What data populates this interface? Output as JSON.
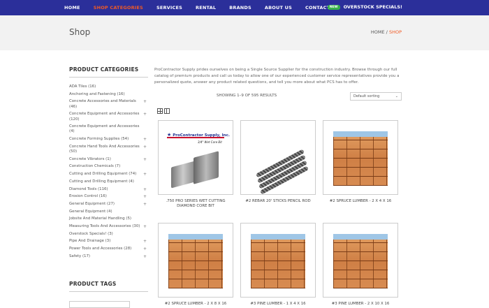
{
  "nav": {
    "items": [
      "HOME",
      "SHOP CATEGORIES",
      "SERVICES",
      "RENTAL",
      "BRANDS",
      "ABOUT US",
      "CONTACT US"
    ],
    "active_index": 1,
    "new_badge": "NEW",
    "special_label": "OVERSTOCK SPECIALS!"
  },
  "page": {
    "title": "Shop",
    "breadcrumb_home": "HOME",
    "breadcrumb_sep": "/",
    "breadcrumb_current": "SHOP"
  },
  "sidebar": {
    "title": "PRODUCT CATEGORIES",
    "categories": [
      {
        "label": "ADA Tiles (16)",
        "expandable": false
      },
      {
        "label": "Anchoring and Fastening (16)",
        "expandable": false
      },
      {
        "label": "Concrete Accessories and Materials (46)",
        "expandable": true
      },
      {
        "label": "Concrete Equipment and Accessories (120)",
        "expandable": true
      },
      {
        "label": "Concrete Equipment and Accessories (4)",
        "expandable": false
      },
      {
        "label": "Concrete Forming Supplies (54)",
        "expandable": true
      },
      {
        "label": "Concrete Hand Tools And Accessories (50)",
        "expandable": true
      },
      {
        "label": "Concrete Vibrators (1)",
        "expandable": true
      },
      {
        "label": "Construction Chemicals (7)",
        "expandable": false
      },
      {
        "label": "Cutting and Drilling Equipment (74)",
        "expandable": true
      },
      {
        "label": "Cutting and Drilling Equipment (4)",
        "expandable": false
      },
      {
        "label": "Diamond Tools (116)",
        "expandable": true
      },
      {
        "label": "Erosion Control (16)",
        "expandable": true
      },
      {
        "label": "General Equipment (27)",
        "expandable": true
      },
      {
        "label": "General Equipment (4)",
        "expandable": false
      },
      {
        "label": "Jobsite And Material Handling (5)",
        "expandable": false
      },
      {
        "label": "Measuring Tools And Accessories (30)",
        "expandable": true
      },
      {
        "label": "Overstock Specials! (3)",
        "expandable": false
      },
      {
        "label": "Pipe And Drainage (3)",
        "expandable": true
      },
      {
        "label": "Power Tools and Accessories (28)",
        "expandable": true
      },
      {
        "label": "Safety (17)",
        "expandable": true
      }
    ],
    "plus_glyph": "+",
    "tags_title": "PRODUCT TAGS"
  },
  "shop": {
    "intro": "ProContractor Supply prides ourselves on being a Single Source Supplier for the construction industry. Browse through our full catalog of premium products and call us today to allow one of our experienced customer service representatives provide you a personalized quote, answer any product related questions, and tell you more about what PCS has to offer.",
    "result_count": "SHOWING 1–9 OF 595 RESULTS",
    "sort_value": "Default sorting",
    "products": [
      {
        "name": ".750 PRO SERIES WET CUTTING DIAMOND CORE BIT",
        "image": "core-bit",
        "logo_text": "ProContractor Supply, Inc.",
        "logo_sub": "3/4\" Wet Core Bit"
      },
      {
        "name": "#2 REBAR 20' STICKS PENCIL ROD",
        "image": "rebar"
      },
      {
        "name": "#2 SPRUCE LUMBER - 2 X 4 X 16",
        "image": "lumber"
      },
      {
        "name": "#2 SPRUCE LUMBER - 2 X 8 X 16",
        "image": "lumber"
      },
      {
        "name": "#3 PINE LUMBER - 1 X 4 X 16",
        "image": "lumber"
      },
      {
        "name": "#3 PINE LUMBER - 2 X 10 X 16",
        "image": "lumber"
      }
    ]
  },
  "colors": {
    "nav_bg": "#2b2f9a",
    "accent": "#f15a24",
    "badge": "#36b24a"
  },
  "icons": {
    "grid_view": "grid-view-icon",
    "list_view": "list-view-icon",
    "sort_arrow": "chevron-down-icon"
  }
}
